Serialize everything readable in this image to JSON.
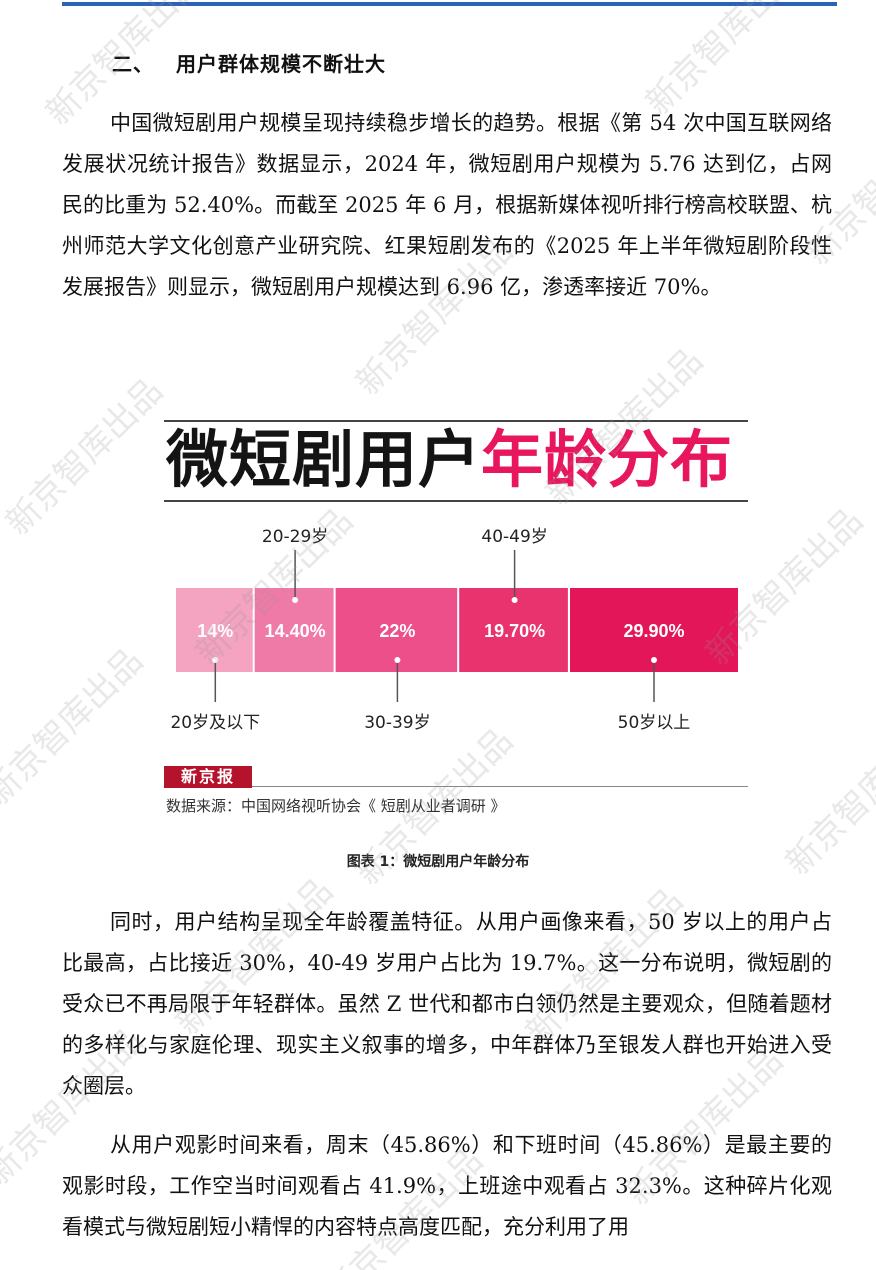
{
  "section": {
    "number": "二、",
    "title": "用户群体规模不断壮大"
  },
  "paragraphs": {
    "p1": "中国微短剧用户规模呈现持续稳步增长的趋势。根据《第 54 次中国互联网络发展状况统计报告》数据显示，2024 年，微短剧用户规模为 5.76 达到亿，占网民的比重为 52.40%。而截至 2025 年 6 月，根据新媒体视听排行榜高校联盟、杭州师范大学文化创意产业研究院、红果短剧发布的《2025 年上半年微短剧阶段性发展报告》则显示，微短剧用户规模达到 6.96 亿，渗透率接近 70%。",
    "p2": "同时，用户结构呈现全年龄覆盖特征。从用户画像来看，50 岁以上的用户占比最高，占比接近 30%，40-49 岁用户占比为 19.7%。这一分布说明，微短剧的受众已不再局限于年轻群体。虽然 Z 世代和都市白领仍然是主要观众，但随着题材的多样化与家庭伦理、现实主义叙事的增多，中年群体乃至银发人群也开始进入受众圈层。",
    "p3": "从用户观影时间来看，周末（45.86%）和下班时间（45.86%）是最主要的观影时段，工作空当时间观看占 41.9%，上班途中观看占 32.3%。这种碎片化观看模式与微短剧短小精悍的内容特点高度匹配，充分利用了用"
  },
  "infographic": {
    "title_black": "微短剧用户",
    "title_red": "年龄分布",
    "brand": "新京报",
    "source": "数据来源：中国网络视听协会《 短剧从业者调研 》"
  },
  "chart_data": {
    "type": "bar",
    "orientation": "horizontal-stacked",
    "categories": [
      "20岁及以下",
      "20-29岁",
      "30-39岁",
      "40-49岁",
      "50岁以上"
    ],
    "value_labels": [
      "14%",
      "14.40%",
      "22%",
      "19.70%",
      "29.90%"
    ],
    "values": [
      14,
      14.4,
      22,
      19.7,
      29.9
    ],
    "colors": [
      "#f4a3c1",
      "#f07aa7",
      "#ec4f8a",
      "#e8336f",
      "#e3165a"
    ],
    "label_positions": [
      "below",
      "above",
      "below",
      "above",
      "below"
    ]
  },
  "caption": "图表 1：微短剧用户年龄分布",
  "watermark_text": "新京智库出品",
  "colors": {
    "accent_blue": "#2b63b8",
    "title_red": "#e8175d",
    "brand_red": "#b5122b"
  }
}
